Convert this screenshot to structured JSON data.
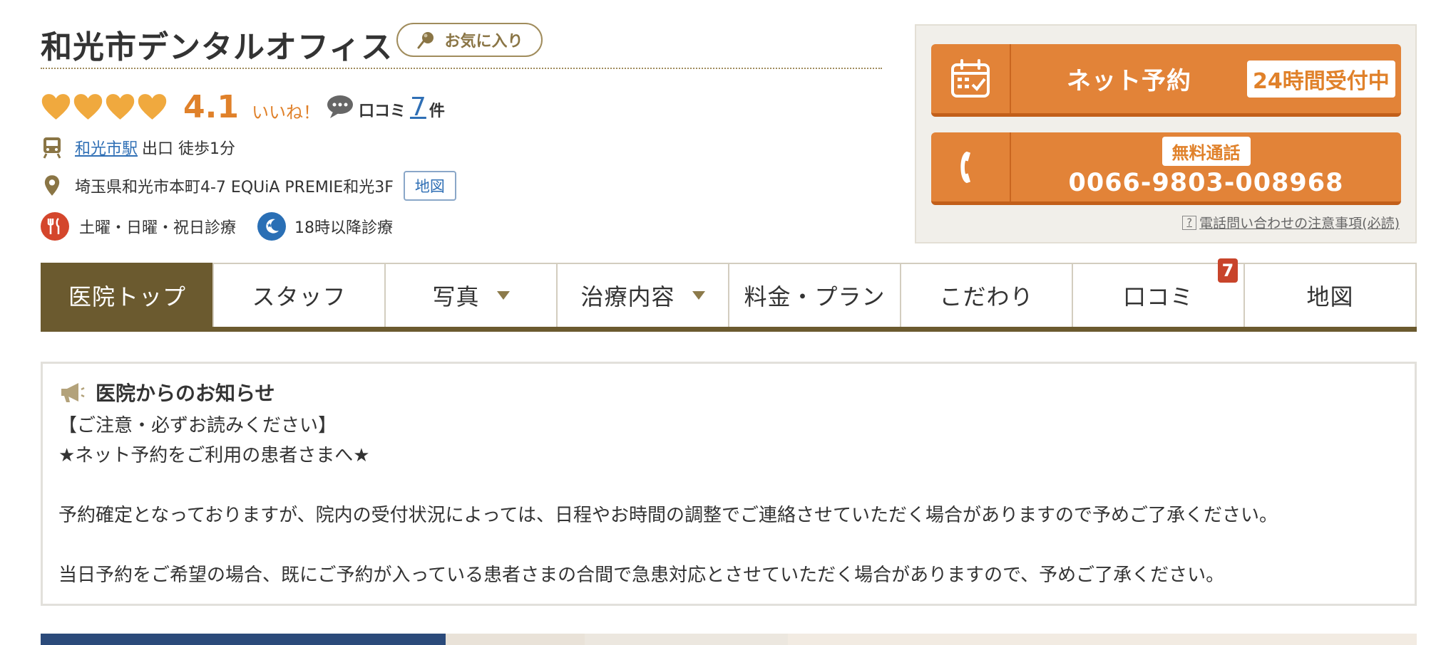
{
  "header": {
    "clinic_name": "和光市デンタルオフィス",
    "favorite_label": "お気に入り"
  },
  "rating": {
    "hearts_filled": 4,
    "score": "4.1",
    "iine": "いいね！",
    "kuchikomi_label": "口コミ",
    "kuchikomi_count": "7",
    "kuchikomi_unit": "件"
  },
  "access": {
    "station": "和光市駅",
    "station_rest": "出口 徒歩1分",
    "address": "埼玉県和光市本町4-7 EQUiA PREMIE和光3F",
    "map_button": "地図"
  },
  "features": {
    "weekend": "土曜・日曜・祝日診療",
    "evening": "18時以降診療"
  },
  "reservation": {
    "net_label": "ネット予約",
    "net_badge": "24時間受付中",
    "tel_badge": "無料通話",
    "tel_number": "0066-9803-008968",
    "notice_link": "電話問い合わせの注意事項(必読)"
  },
  "tabs": [
    {
      "label": "医院トップ"
    },
    {
      "label": "スタッフ"
    },
    {
      "label": "写真"
    },
    {
      "label": "治療内容"
    },
    {
      "label": "料金・プラン"
    },
    {
      "label": "こだわり"
    },
    {
      "label": "口コミ",
      "badge": "7"
    },
    {
      "label": "地図"
    }
  ],
  "notice": {
    "title": "医院からのお知らせ",
    "line1": "【ご注意・必ずお読みください】",
    "line2": "★ネット予約をご利用の患者さまへ★",
    "line3": "予約確定となっておりますが、院内の受付状況によっては、日程やお時間の調整でご連絡させていただく場合がありますので予めご了承ください。",
    "line4": "当日予約をご希望の場合、既にご予約が入っている患者さまの合間で急患対応とさせていただく場合がありますので、予めご了承ください。"
  },
  "colors": {
    "accent_orange": "#e28338",
    "brand_brown": "#6b5a2f",
    "link_blue": "#2f6fb5",
    "badge_red": "#c8442b"
  }
}
